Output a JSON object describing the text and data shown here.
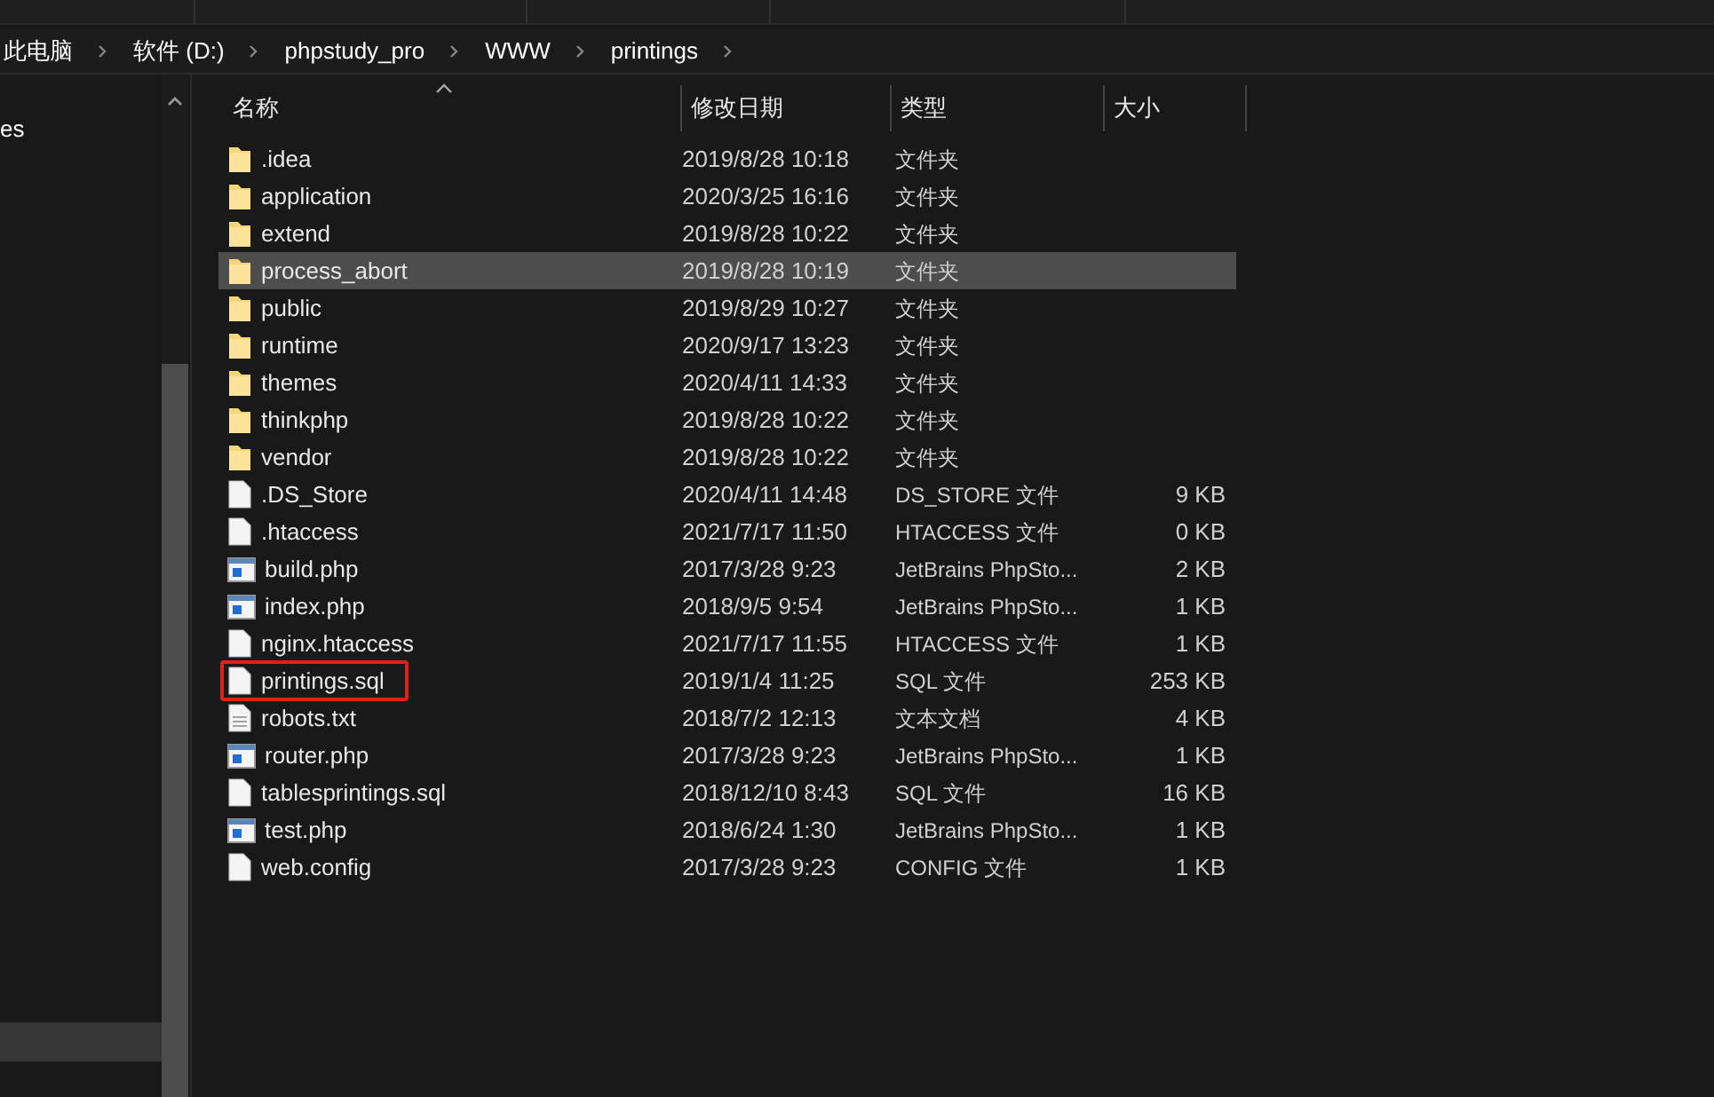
{
  "breadcrumb": [
    "此电脑",
    "软件 (D:)",
    "phpstudy_pro",
    "WWW",
    "printings"
  ],
  "sidebar": {
    "items": [
      {
        "label": "es",
        "selected": false
      },
      {
        "selected": true
      }
    ]
  },
  "table": {
    "columns": [
      "名称",
      "修改日期",
      "类型",
      "大小"
    ],
    "rows": [
      {
        "kind": "folder",
        "name": ".idea",
        "date": "2019/8/28 10:18",
        "type": "文件夹",
        "size": "",
        "selected": false,
        "marked": false
      },
      {
        "kind": "folder",
        "name": "application",
        "date": "2020/3/25 16:16",
        "type": "文件夹",
        "size": "",
        "selected": false,
        "marked": false
      },
      {
        "kind": "folder",
        "name": "extend",
        "date": "2019/8/28 10:22",
        "type": "文件夹",
        "size": "",
        "selected": false,
        "marked": false
      },
      {
        "kind": "folder",
        "name": "process_abort",
        "date": "2019/8/28 10:19",
        "type": "文件夹",
        "size": "",
        "selected": true,
        "marked": false
      },
      {
        "kind": "folder",
        "name": "public",
        "date": "2019/8/29 10:27",
        "type": "文件夹",
        "size": "",
        "selected": false,
        "marked": false
      },
      {
        "kind": "folder",
        "name": "runtime",
        "date": "2020/9/17 13:23",
        "type": "文件夹",
        "size": "",
        "selected": false,
        "marked": false
      },
      {
        "kind": "folder",
        "name": "themes",
        "date": "2020/4/11 14:33",
        "type": "文件夹",
        "size": "",
        "selected": false,
        "marked": false
      },
      {
        "kind": "folder",
        "name": "thinkphp",
        "date": "2019/8/28 10:22",
        "type": "文件夹",
        "size": "",
        "selected": false,
        "marked": false
      },
      {
        "kind": "folder",
        "name": "vendor",
        "date": "2019/8/28 10:22",
        "type": "文件夹",
        "size": "",
        "selected": false,
        "marked": false
      },
      {
        "kind": "file",
        "name": ".DS_Store",
        "date": "2020/4/11 14:48",
        "type": "DS_STORE 文件",
        "size": "9 KB",
        "selected": false,
        "marked": false
      },
      {
        "kind": "file",
        "name": ".htaccess",
        "date": "2021/7/17 11:50",
        "type": "HTACCESS 文件",
        "size": "0 KB",
        "selected": false,
        "marked": false
      },
      {
        "kind": "php",
        "name": "build.php",
        "date": "2017/3/28 9:23",
        "type": "JetBrains PhpSto...",
        "size": "2 KB",
        "selected": false,
        "marked": false
      },
      {
        "kind": "php",
        "name": "index.php",
        "date": "2018/9/5 9:54",
        "type": "JetBrains PhpSto...",
        "size": "1 KB",
        "selected": false,
        "marked": false
      },
      {
        "kind": "file",
        "name": "nginx.htaccess",
        "date": "2021/7/17 11:55",
        "type": "HTACCESS 文件",
        "size": "1 KB",
        "selected": false,
        "marked": false
      },
      {
        "kind": "file",
        "name": "printings.sql",
        "date": "2019/1/4 11:25",
        "type": "SQL 文件",
        "size": "253 KB",
        "selected": false,
        "marked": true
      },
      {
        "kind": "text",
        "name": "robots.txt",
        "date": "2018/7/2 12:13",
        "type": "文本文档",
        "size": "4 KB",
        "selected": false,
        "marked": false
      },
      {
        "kind": "php",
        "name": "router.php",
        "date": "2017/3/28 9:23",
        "type": "JetBrains PhpSto...",
        "size": "1 KB",
        "selected": false,
        "marked": false
      },
      {
        "kind": "file",
        "name": "tablesprintings.sql",
        "date": "2018/12/10 8:43",
        "type": "SQL 文件",
        "size": "16 KB",
        "selected": false,
        "marked": false
      },
      {
        "kind": "php",
        "name": "test.php",
        "date": "2018/6/24 1:30",
        "type": "JetBrains PhpSto...",
        "size": "1 KB",
        "selected": false,
        "marked": false
      },
      {
        "kind": "file",
        "name": "web.config",
        "date": "2017/3/28 9:23",
        "type": "CONFIG 文件",
        "size": "1 KB",
        "selected": false,
        "marked": false
      }
    ]
  }
}
